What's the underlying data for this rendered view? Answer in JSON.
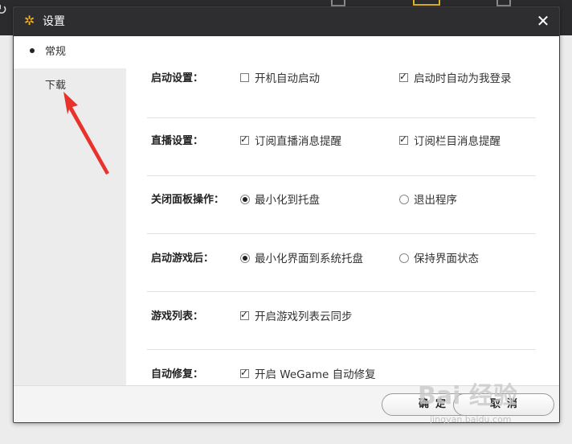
{
  "background": {
    "refresh_icon": "refresh-icon"
  },
  "dialog": {
    "title": "设置",
    "title_icon": "gear-icon",
    "close_icon": "close-icon"
  },
  "sidebar": {
    "items": [
      {
        "label": "常规",
        "active": true
      },
      {
        "label": "下载",
        "active": false
      }
    ]
  },
  "settings": [
    {
      "label": "启动设置：",
      "type": "checkbox",
      "options": [
        {
          "text": "开机自动启动",
          "checked": false
        },
        {
          "text": "启动时自动为我登录",
          "checked": true
        }
      ]
    },
    {
      "label": "直播设置：",
      "type": "checkbox",
      "options": [
        {
          "text": "订阅直播消息提醒",
          "checked": true
        },
        {
          "text": "订阅栏目消息提醒",
          "checked": true
        }
      ]
    },
    {
      "label": "关闭面板操作：",
      "type": "radio",
      "options": [
        {
          "text": "最小化到托盘",
          "checked": true
        },
        {
          "text": "退出程序",
          "checked": false
        }
      ]
    },
    {
      "label": "启动游戏后：",
      "type": "radio",
      "options": [
        {
          "text": "最小化界面到系统托盘",
          "checked": true
        },
        {
          "text": "保持界面状态",
          "checked": false
        }
      ]
    },
    {
      "label": "游戏列表：",
      "type": "checkbox",
      "options": [
        {
          "text": "开启游戏列表云同步",
          "checked": true
        }
      ]
    },
    {
      "label": "自动修复：",
      "type": "checkbox",
      "options": [
        {
          "text": "开启 WeGame 自动修复",
          "checked": true
        }
      ]
    }
  ],
  "footer": {
    "ok_label": "确定",
    "cancel_label": "取消"
  },
  "annotation": {
    "icon": "red-arrow-icon",
    "color": "#e8322b"
  },
  "watermark": {
    "text": "Bai 经验",
    "url": "jingyan.baidu.com"
  }
}
